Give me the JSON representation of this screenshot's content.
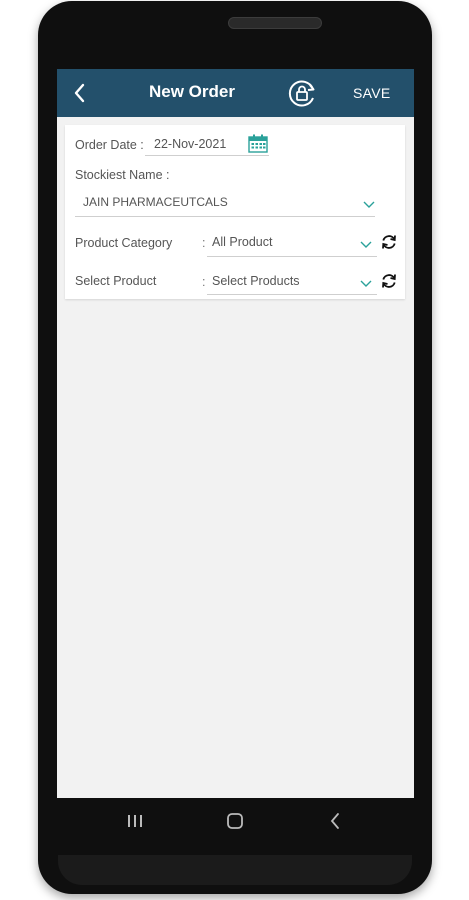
{
  "header": {
    "title": "New Order",
    "save_label": "SAVE",
    "bar_color": "#23506b",
    "icons": [
      "back-arrow-icon",
      "sync-lock-icon"
    ]
  },
  "form": {
    "order_date": {
      "label": "Order Date :",
      "value": "22-Nov-2021",
      "icon": "calendar-icon"
    },
    "stockist": {
      "label": "Stockiest Name :",
      "value": "JAIN PHARMACEUTCALS"
    },
    "product_category": {
      "label": "Product Category",
      "separator": ":",
      "value": "All Product"
    },
    "select_product": {
      "label": "Select Product",
      "separator": ":",
      "value": "Select Products"
    },
    "accent_color": "#2aa19a"
  },
  "navbar": {
    "buttons": [
      "recents",
      "home",
      "back"
    ]
  }
}
